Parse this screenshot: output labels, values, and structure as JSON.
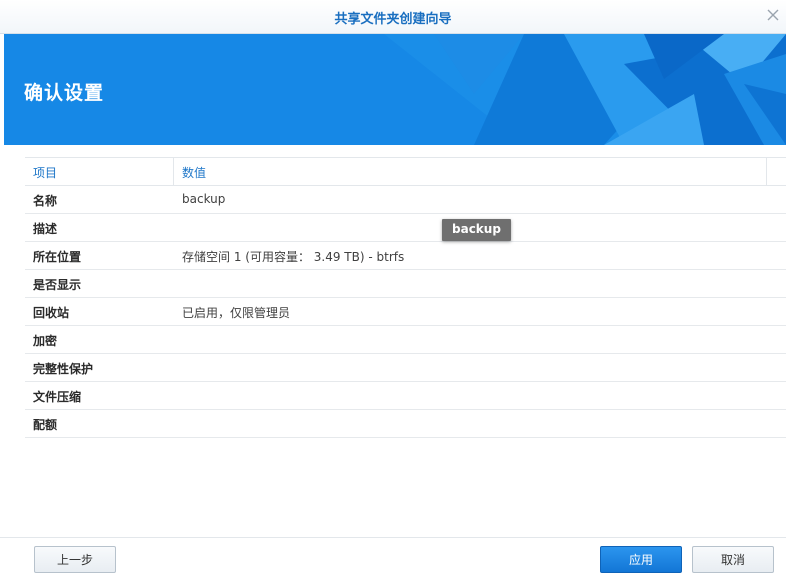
{
  "window": {
    "title": "共享文件夹创建向导"
  },
  "banner": {
    "heading": "确认设置"
  },
  "table": {
    "headers": [
      "项目",
      "数值"
    ],
    "rows": [
      {
        "key": "名称",
        "value": "backup"
      },
      {
        "key": "描述",
        "value": ""
      },
      {
        "key": "所在位置",
        "value": "存储空间 1 (可用容量： 3.49 TB) - btrfs"
      },
      {
        "key": "是否显示",
        "value": ""
      },
      {
        "key": "回收站",
        "value": "已启用，仅限管理员"
      },
      {
        "key": "加密",
        "value": ""
      },
      {
        "key": "完整性保护",
        "value": ""
      },
      {
        "key": "文件压缩",
        "value": ""
      },
      {
        "key": "配额",
        "value": ""
      }
    ]
  },
  "tooltip": {
    "text": "backup"
  },
  "footer": {
    "back_label": "上一步",
    "apply_label": "应用",
    "cancel_label": "取消"
  },
  "icons": {
    "close": "close-icon"
  },
  "colors": {
    "accent": "#1285e4",
    "title_text": "#1a6fc0",
    "header_text": "#1d76c8",
    "tooltip_bg": "#6f6f6f"
  }
}
